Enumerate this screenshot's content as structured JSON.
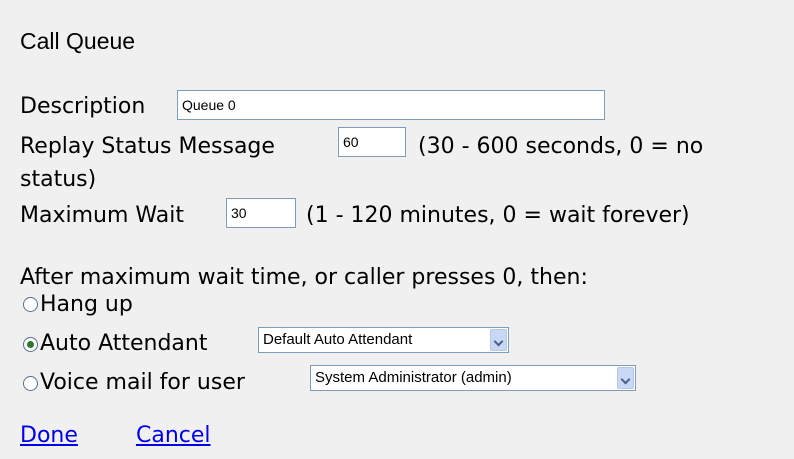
{
  "title": "Call Queue",
  "description": {
    "label": "Description",
    "value": "Queue 0"
  },
  "replay_status": {
    "label": "Replay Status Message",
    "value": "60",
    "hint_line1": "(30 - 600 seconds, 0 = no",
    "hint_line2": "status)"
  },
  "maximum_wait": {
    "label": "Maximum Wait",
    "value": "30",
    "hint": "(1 - 120 minutes, 0 = wait forever)"
  },
  "after_wait": {
    "prompt": "After maximum wait time, or caller presses 0, then:",
    "options": [
      {
        "label": "Hang up",
        "selected": false
      },
      {
        "label": "Auto Attendant",
        "selected": true,
        "select_value": "Default Auto Attendant"
      },
      {
        "label": "Voice mail for user",
        "selected": false,
        "select_value": "System Administrator (admin)"
      }
    ]
  },
  "actions": {
    "done": "Done",
    "cancel": "Cancel"
  }
}
